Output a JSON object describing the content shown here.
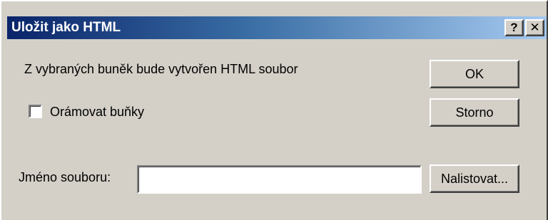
{
  "window": {
    "title": "Uložit jako HTML",
    "help_label": "?",
    "close_label": "✕"
  },
  "content": {
    "info_text": "Z vybraných buněk bude vytvořen HTML soubor",
    "checkbox_label": "Orámovat buňky",
    "checkbox_checked": false,
    "filename_label": "Jméno souboru:",
    "filename_value": "",
    "filename_placeholder": ""
  },
  "buttons": {
    "ok_label": "OK",
    "cancel_label": "Storno",
    "browse_label": "Nalistovat..."
  },
  "colors": {
    "title_bar_start": "#0a246a",
    "title_bar_end": "#a6caf0",
    "dialog_face": "#d4d0c8"
  }
}
